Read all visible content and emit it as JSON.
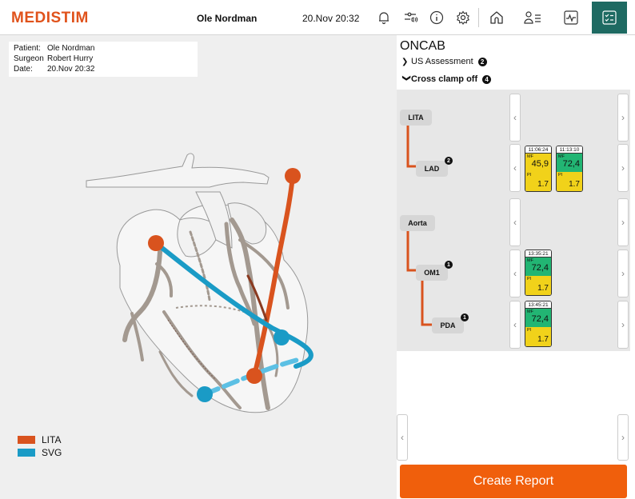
{
  "header": {
    "logo": "MEDISTIM",
    "patient": "Ole Nordman",
    "datetime": "20.Nov 20:32"
  },
  "info": {
    "patient_label": "Patient:",
    "patient_value": "Ole Nordman",
    "surgeon_label": "Surgeon",
    "surgeon_value": "Robert Hurry",
    "date_label": "Date:",
    "date_value": "20.Nov 20:32"
  },
  "legend": [
    {
      "label": "LITA",
      "color": "#d9531e"
    },
    {
      "label": "SVG",
      "color": "#1a9bc6"
    }
  ],
  "panel": {
    "title": "ONCAB",
    "sections": [
      {
        "label": "US Assessment",
        "count": "2",
        "expanded": false
      },
      {
        "label": "Cross clamp off",
        "count": "4",
        "expanded": true
      }
    ],
    "nodes": {
      "lita": "LITA",
      "lad": "LAD",
      "lad_badge": "2",
      "aorta": "Aorta",
      "om1": "OM1",
      "om1_badge": "1",
      "pda": "PDA",
      "pda_badge": "1"
    },
    "measurements": [
      {
        "time": "11:06:24",
        "mf_label": "MF",
        "mf": "45,9",
        "pi_label": "PI",
        "pi": "1.7",
        "mf_color": "#f1d21a"
      },
      {
        "time": "11:13:10",
        "mf_label": "MF",
        "mf": "72,4",
        "pi_label": "PI",
        "pi": "1.7",
        "mf_color": "#22b573"
      },
      {
        "time": "13:35:21",
        "mf_label": "MF",
        "mf": "72,4",
        "pi_label": "PI",
        "pi": "1.7",
        "mf_color": "#22b573"
      },
      {
        "time": "13:45:21",
        "mf_label": "MF",
        "mf": "72,4",
        "pi_label": "PI",
        "pi": "1.7",
        "mf_color": "#22b573"
      }
    ],
    "create_report": "Create Report"
  },
  "colors": {
    "accent": "#e0521b",
    "active_tab": "#1e6a62",
    "button": "#f05f0c",
    "lita": "#d9531e",
    "svg": "#1a9bc6"
  }
}
